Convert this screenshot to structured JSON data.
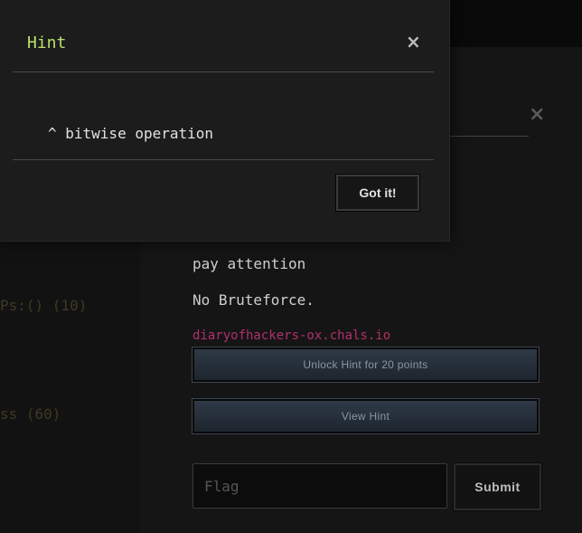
{
  "background_list": {
    "items": [
      {
        "label": "Ps:() (10)"
      },
      {
        "label": "ss (60)"
      }
    ]
  },
  "challenge": {
    "close_icon": "close-icon",
    "description": [
      "pay attention",
      "No Bruteforce."
    ],
    "link_text": "diaryofhackers-ox.chals.io",
    "unlock_hint_label": "Unlock Hint for 20 points",
    "view_hint_label": "View Hint",
    "flag_placeholder": "Flag",
    "submit_label": "Submit"
  },
  "hint_modal": {
    "title": "Hint",
    "close_symbol": "×",
    "body": "^ bitwise operation",
    "confirm_label": "Got it!"
  },
  "colors": {
    "hint_title": "#b8e36a",
    "link": "#b0306a",
    "button_gradient_top": "#2f3a46"
  }
}
